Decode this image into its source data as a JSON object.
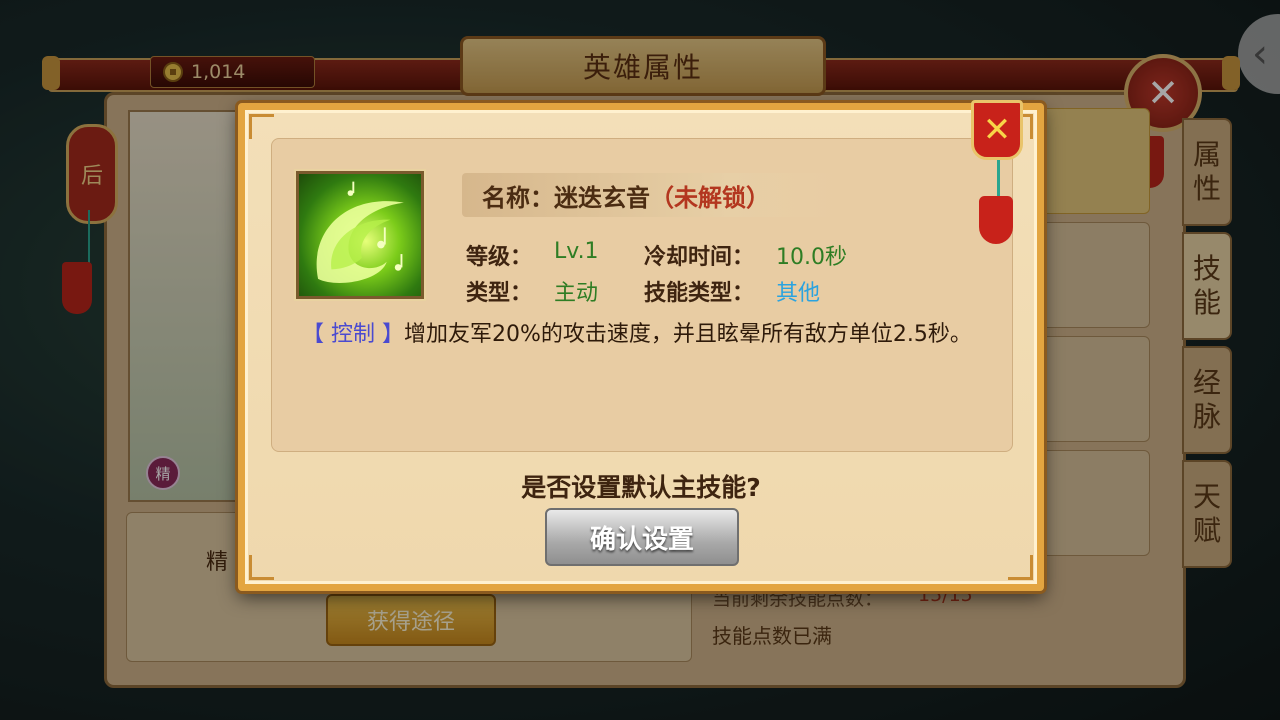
{
  "header": {
    "coins": "1,014",
    "title": "英雄属性",
    "close_symbol": "✕",
    "back_symbol": "‹"
  },
  "left_tassel": {
    "char": "后"
  },
  "hero_panel": {
    "quality_badge": "精",
    "jing_label": "精",
    "obtain_button": "获得途径"
  },
  "side_tabs": [
    "属性",
    "技能",
    "经脉",
    "天赋"
  ],
  "skill_points": {
    "remaining_label": "当前剩余技能点数：",
    "remaining_value": "15/15",
    "full_text": "技能点数已满"
  },
  "dialog": {
    "name_label": "名称：",
    "skill_name": "迷迭玄音",
    "lock_status": "（未解锁）",
    "level_label": "等级：",
    "level_value": "Lv.1",
    "cooldown_label": "冷却时间：",
    "cooldown_value": "10.0秒",
    "type_label": "类型：",
    "type_value": "主动",
    "skill_type_label": "技能类型：",
    "skill_type_value": "其他",
    "tag": "【 控制 】",
    "description": "增加友军20%的攻击速度，并且眩晕所有敌方单位2.5秒。",
    "question": "是否设置默认主技能?",
    "confirm_button": "确认设置",
    "close_symbol": "✕"
  },
  "colors": {
    "accent_gold": "#e3a540",
    "value_green": "#2e7d24",
    "value_blue": "#2aa3e0",
    "lock_red": "#b3361f",
    "tag_blue": "#4a4ad0"
  }
}
